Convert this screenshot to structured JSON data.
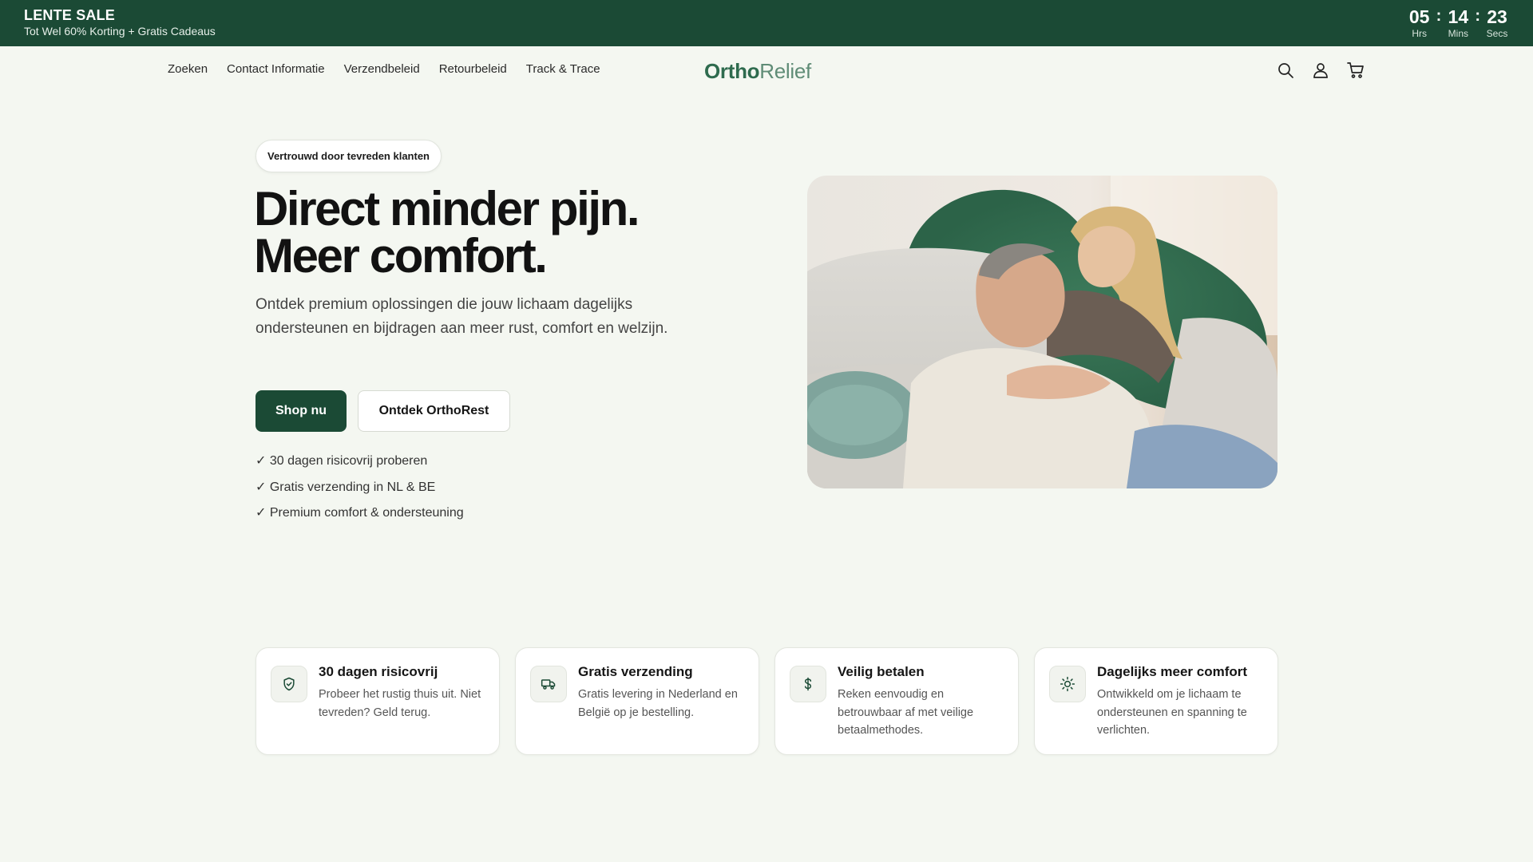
{
  "announcement": {
    "title": "LENTE SALE",
    "subtitle": "Tot Wel 60% Korting + Gratis Cadeaus",
    "countdown": [
      {
        "value": "05",
        "label": "Hrs"
      },
      {
        "value": "14",
        "label": "Mins"
      },
      {
        "value": "23",
        "label": "Secs"
      }
    ],
    "separator": ":"
  },
  "header": {
    "nav": [
      "Zoeken",
      "Contact Informatie",
      "Verzendbeleid",
      "Retourbeleid",
      "Track & Trace"
    ],
    "logo_bold": "Ortho",
    "logo_light": "Relief",
    "icons": [
      "search-icon",
      "account-icon",
      "cart-icon"
    ]
  },
  "hero": {
    "badge": "Vertrouwd door tevreden klanten",
    "title_line1": "Direct minder pijn.",
    "title_line2": "Meer comfort.",
    "description": "Ontdek premium oplossingen die jouw lichaam dagelijks ondersteunen en bijdragen aan meer rust, comfort en welzijn.",
    "primary_button": "Shop nu",
    "secondary_button": "Ontdek OrthoRest",
    "checks": [
      "✓ 30 dagen risicovrij proberen",
      "✓ Gratis verzending in NL & BE",
      "✓ Premium comfort & ondersteuning"
    ]
  },
  "features": [
    {
      "icon": "shield-check-icon",
      "title": "30 dagen risicovrij",
      "text": "Probeer het rustig thuis uit. Niet tevreden? Geld terug."
    },
    {
      "icon": "truck-icon",
      "title": "Gratis verzending",
      "text": "Gratis levering in Nederland en België op je bestelling."
    },
    {
      "icon": "dollar-icon",
      "title": "Veilig betalen",
      "text": "Reken eenvoudig en betrouwbaar af met veilige betaalmethodes."
    },
    {
      "icon": "sun-icon",
      "title": "Dagelijks meer comfort",
      "text": "Ontwikkeld om je lichaam te ondersteunen en spanning te verlichten."
    }
  ],
  "colors": {
    "brand_dark": "#1b4a35",
    "brand_green": "#2e6b4e",
    "background": "#f4f7f1"
  }
}
